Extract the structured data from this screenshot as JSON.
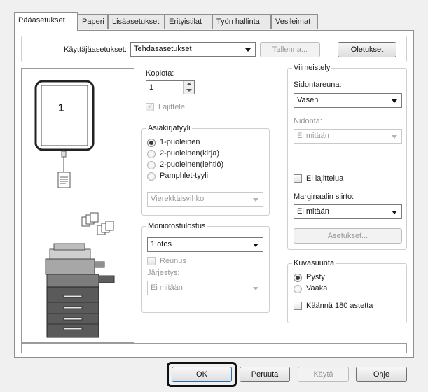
{
  "tabs": [
    {
      "label": "Pääasetukset",
      "active": true
    },
    {
      "label": "Paperi"
    },
    {
      "label": "Lisäasetukset"
    },
    {
      "label": "Erityistilat"
    },
    {
      "label": "Työn hallinta"
    },
    {
      "label": "Vesileimat"
    }
  ],
  "user_settings": {
    "label": "Käyttäjäasetukset:",
    "value": "Tehdasasetukset",
    "save_label": "Tallenna...",
    "defaults_label": "Oletukset"
  },
  "preview": {
    "page_number": "1"
  },
  "copies": {
    "label": "Kopiota:",
    "value": "1",
    "collate_label": "Lajittele"
  },
  "document_style": {
    "legend": "Asiakirjatyyli",
    "options": [
      "1-puoleinen",
      "2-puoleinen(kirja)",
      "2-puoleinen(lehtiö)",
      "Pamphlet-tyyli"
    ],
    "selected": 0,
    "booklet_value": "Vierekkäisvihko"
  },
  "nup": {
    "legend": "Moniotostulostus",
    "value": "1 otos",
    "border_label": "Reunus",
    "order_label": "Järjestys:",
    "order_value": "Ei mitään"
  },
  "finishing": {
    "legend": "Viimeistely",
    "binding_edge_label": "Sidontareuna:",
    "binding_edge_value": "Vasen",
    "staple_label": "Nidonta:",
    "staple_value": "Ei mitään",
    "no_offset_label": "Ei lajittelua",
    "margin_shift_label": "Marginaalin siirto:",
    "margin_shift_value": "Ei mitään",
    "settings_label": "Asetukset..."
  },
  "orientation": {
    "legend": "Kuvasuunta",
    "options": [
      "Pysty",
      "Vaaka"
    ],
    "selected": 0,
    "rotate_label": "Käännä 180 astetta"
  },
  "footer": {
    "ok_label": "OK",
    "cancel_label": "Peruuta",
    "apply_label": "Käytä",
    "help_label": "Ohje"
  },
  "colors": {
    "highlight": "#111111",
    "panel_bg": "#ffffff",
    "window_bg": "#f0f0f0"
  }
}
